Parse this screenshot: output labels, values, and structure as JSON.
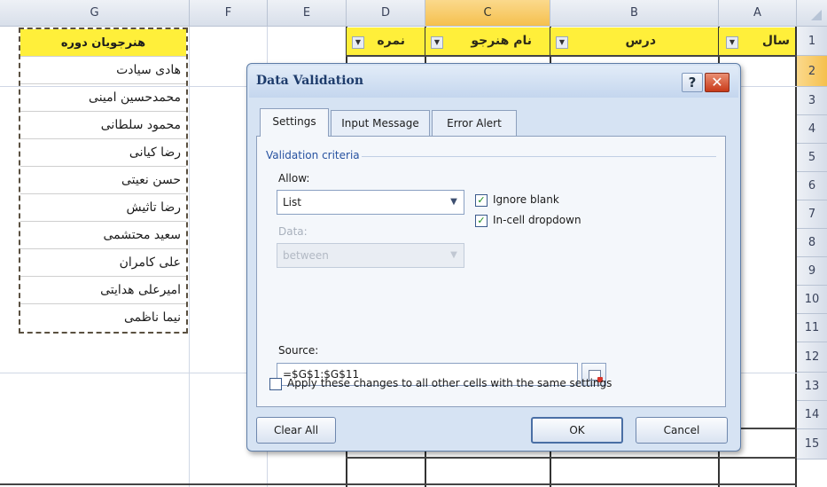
{
  "spreadsheet": {
    "column_headers": [
      "G",
      "F",
      "E",
      "D",
      "C",
      "B",
      "A"
    ],
    "row_numbers": [
      "1",
      "2",
      "3",
      "4",
      "5",
      "6",
      "7",
      "8",
      "9",
      "10",
      "11",
      "12",
      "13",
      "14",
      "15"
    ],
    "header_row": {
      "A": "سال",
      "B": "درس",
      "C": "نام هنرجو",
      "D": "نمره",
      "G": "هنرجویان دوره"
    },
    "students": [
      "هادی سیادت",
      "محمدحسین امینی",
      "محمود سلطانی",
      "رضا کیانی",
      "حسن نعیتی",
      "رضا تاثیش",
      "سعید محتشمی",
      "علی کامران",
      "امیرعلی هدایتی",
      "نیما ناظمی"
    ],
    "filter_glyph": "▼"
  },
  "dialog": {
    "title": "Data Validation",
    "help_glyph": "?",
    "close_glyph": "✕",
    "tabs": [
      "Settings",
      "Input Message",
      "Error Alert"
    ],
    "group_label": "Validation criteria",
    "allow_label": "Allow:",
    "allow_value": "List",
    "data_label": "Data:",
    "data_value": "between",
    "ignore_blank_label": "Ignore blank",
    "in_cell_dropdown_label": "In-cell dropdown",
    "source_label": "Source:",
    "source_value": "=$G$1:$G$11",
    "apply_label": "Apply these changes to all other cells with the same settings",
    "clear_all": "Clear All",
    "ok": "OK",
    "cancel": "Cancel",
    "check_glyph": "✓",
    "dropdown_glyph": "▼"
  },
  "colors": {
    "header_yellow": "#ffef3a",
    "selected_header": "#f5c04e",
    "dialog_bg": "#d6e3f3",
    "title_text": "#1d3b6b"
  }
}
